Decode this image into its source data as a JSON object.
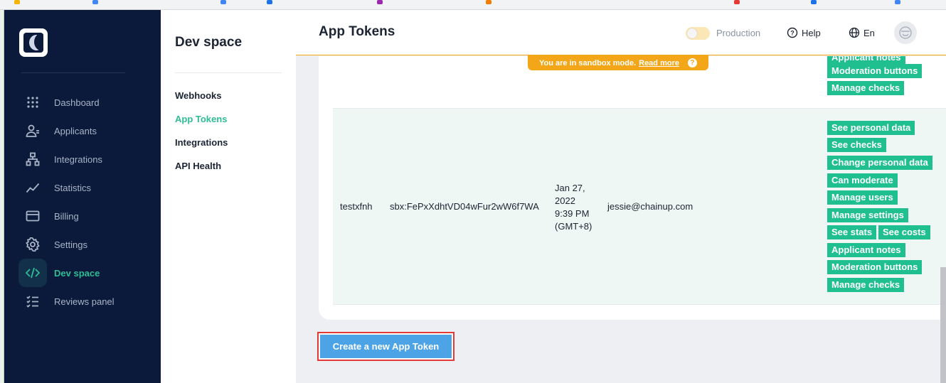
{
  "sidebar": {
    "items": [
      {
        "label": "Dashboard",
        "icon": "dashboard-grid-icon"
      },
      {
        "label": "Applicants",
        "icon": "applicants-icon"
      },
      {
        "label": "Integrations",
        "icon": "integrations-icon"
      },
      {
        "label": "Statistics",
        "icon": "statistics-icon"
      },
      {
        "label": "Billing",
        "icon": "billing-icon"
      },
      {
        "label": "Settings",
        "icon": "settings-gear-icon"
      },
      {
        "label": "Dev space",
        "icon": "code-icon",
        "active": true
      },
      {
        "label": "Reviews panel",
        "icon": "reviews-list-icon"
      }
    ]
  },
  "submenu": {
    "title": "Dev space",
    "items": [
      {
        "label": "Webhooks"
      },
      {
        "label": "App Tokens",
        "active": true
      },
      {
        "label": "Integrations"
      },
      {
        "label": "API Health"
      }
    ]
  },
  "header": {
    "title": "App Tokens",
    "environment_label": "Production",
    "help_label": "Help",
    "language_label": "En"
  },
  "sandbox_banner": {
    "text": "You are in sandbox mode.",
    "link": "Read more",
    "help_glyph": "?"
  },
  "table": {
    "top_row_permissions": [
      "Applicant notes",
      "Moderation buttons",
      "Manage checks"
    ],
    "row": {
      "name": "testxfnh",
      "token": "sbx:FePxXdhtVD04wFur2wW6f7WA",
      "date_lines": [
        "Jan 27,",
        "2022",
        "9:39 PM",
        "(GMT+8)"
      ],
      "email": "jessie@chainup.com",
      "permissions": [
        "See personal data",
        "See checks",
        "Change personal data",
        "Can moderate",
        "Manage users",
        "Manage settings",
        "See stats",
        "See costs",
        "Applicant notes",
        "Moderation buttons",
        "Manage checks"
      ]
    }
  },
  "create_button": {
    "label": "Create a new App Token"
  },
  "colors": {
    "sidebar_bg": "#0b1a3a",
    "accent_green": "#2dbd96",
    "tag_green": "#1fbf8f",
    "sandbox_orange": "#f2a618",
    "button_blue": "#4ca3e6",
    "highlight_red": "#e53935"
  }
}
